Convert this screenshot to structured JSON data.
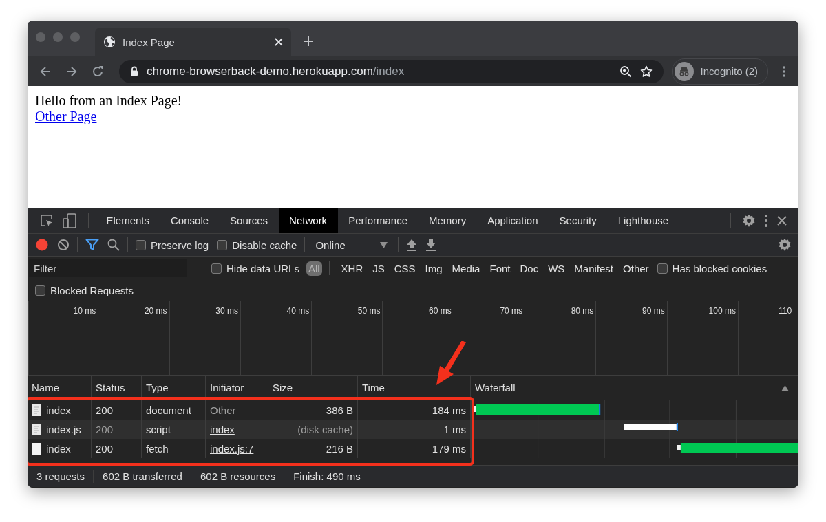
{
  "browser": {
    "tab": {
      "title": "Index Page"
    },
    "address": {
      "host": "chrome-browserback-demo.herokuapp.com",
      "path": "/index"
    },
    "profile": {
      "label": "Incognito (2)"
    }
  },
  "page": {
    "heading": "Hello from an Index Page!",
    "link": "Other Page"
  },
  "devtools": {
    "tabs": [
      {
        "label": "Elements",
        "selected": false
      },
      {
        "label": "Console",
        "selected": false
      },
      {
        "label": "Sources",
        "selected": false
      },
      {
        "label": "Network",
        "selected": true
      },
      {
        "label": "Performance",
        "selected": false
      },
      {
        "label": "Memory",
        "selected": false
      },
      {
        "label": "Application",
        "selected": false
      },
      {
        "label": "Security",
        "selected": false
      },
      {
        "label": "Lighthouse",
        "selected": false
      }
    ],
    "toolbar": {
      "recording": true,
      "preserve_log": {
        "label": "Preserve log",
        "checked": false
      },
      "disable_cache": {
        "label": "Disable cache",
        "checked": false
      },
      "throttling": "Online"
    },
    "filter": {
      "placeholder": "Filter",
      "hide_data_urls": {
        "label": "Hide data URLs",
        "checked": false
      },
      "types": [
        {
          "label": "All",
          "selected": true
        },
        {
          "label": "XHR",
          "selected": false
        },
        {
          "label": "JS",
          "selected": false
        },
        {
          "label": "CSS",
          "selected": false
        },
        {
          "label": "Img",
          "selected": false
        },
        {
          "label": "Media",
          "selected": false
        },
        {
          "label": "Font",
          "selected": false
        },
        {
          "label": "Doc",
          "selected": false
        },
        {
          "label": "WS",
          "selected": false
        },
        {
          "label": "Manifest",
          "selected": false
        },
        {
          "label": "Other",
          "selected": false
        }
      ],
      "has_blocked_cookies": {
        "label": "Has blocked cookies",
        "checked": false
      },
      "blocked_requests": {
        "label": "Blocked Requests",
        "checked": false
      }
    },
    "overview": {
      "ticks": [
        "10 ms",
        "20 ms",
        "30 ms",
        "40 ms",
        "50 ms",
        "60 ms",
        "70 ms",
        "80 ms",
        "90 ms",
        "100 ms",
        "110"
      ]
    },
    "table": {
      "columns": [
        "Name",
        "Status",
        "Type",
        "Initiator",
        "Size",
        "Time",
        "Waterfall"
      ],
      "rows": [
        {
          "kind": "document",
          "name": "index",
          "status": "200",
          "type": "document",
          "initiator": "Other",
          "initiator_link": false,
          "size": "386 B",
          "time": "184 ms",
          "cached": false
        },
        {
          "kind": "document",
          "name": "index.js",
          "status": "200",
          "type": "script",
          "initiator": "index",
          "initiator_link": true,
          "size": "(disk cache)",
          "time": "1 ms",
          "cached": true
        },
        {
          "kind": "blank",
          "name": "index",
          "status": "200",
          "type": "fetch",
          "initiator": "index.js:7",
          "initiator_link": true,
          "size": "216 B",
          "time": "179 ms",
          "cached": false
        }
      ]
    },
    "status_bar": [
      "3 requests",
      "602 B transferred",
      "602 B resources",
      "Finish: 490 ms"
    ]
  }
}
